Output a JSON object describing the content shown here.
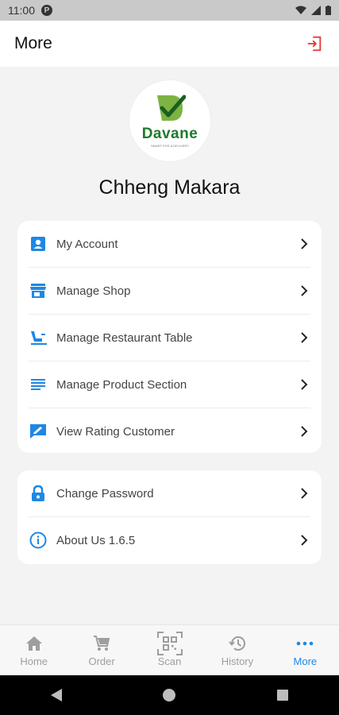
{
  "status": {
    "time": "11:00",
    "badge": "P"
  },
  "header": {
    "title": "More",
    "logout_icon": "logout-icon"
  },
  "logo": {
    "brand": "Davane",
    "tagline": "SMART POS & DELIVERY"
  },
  "user": {
    "name": "Chheng Makara"
  },
  "menu_main": [
    {
      "label": "My Account",
      "icon": "account-icon"
    },
    {
      "label": "Manage Shop",
      "icon": "shop-icon"
    },
    {
      "label": "Manage Restaurant Table",
      "icon": "seat-icon"
    },
    {
      "label": "Manage Product Section",
      "icon": "list-icon"
    },
    {
      "label": "View Rating Customer",
      "icon": "rating-icon"
    }
  ],
  "menu_secondary": [
    {
      "label": "Change Password",
      "icon": "lock-icon"
    },
    {
      "label": "About Us 1.6.5",
      "icon": "info-icon"
    }
  ],
  "bottom_nav": [
    {
      "label": "Home",
      "icon": "home-icon"
    },
    {
      "label": "Order",
      "icon": "cart-icon"
    },
    {
      "label": "Scan",
      "icon": "qr-scan-icon"
    },
    {
      "label": "History",
      "icon": "history-icon"
    },
    {
      "label": "More",
      "icon": "more-icon",
      "active": true
    }
  ],
  "colors": {
    "accent": "#1e88e5",
    "danger": "#e53935",
    "brand_green": "#1e7a2c"
  }
}
